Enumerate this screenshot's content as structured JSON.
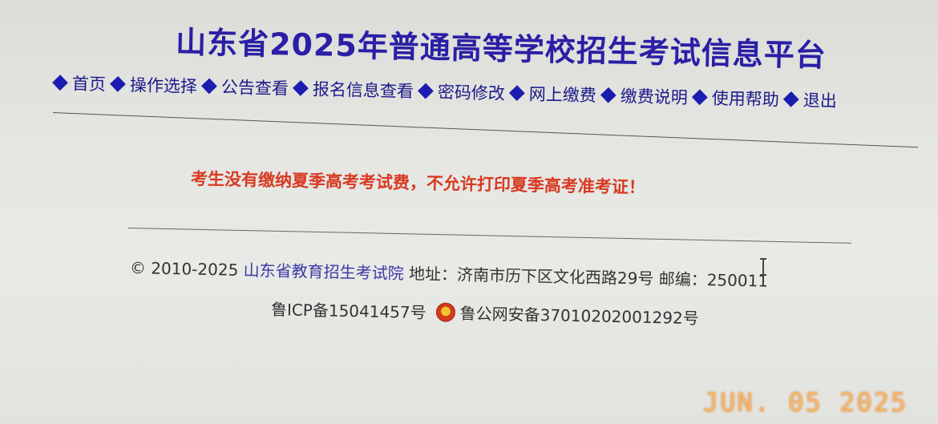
{
  "header": {
    "title": "山东省2025年普通高等学校招生考试信息平台"
  },
  "nav": {
    "items": [
      {
        "label": "首页"
      },
      {
        "label": "操作选择"
      },
      {
        "label": "公告查看"
      },
      {
        "label": "报名信息查看"
      },
      {
        "label": "密码修改"
      },
      {
        "label": "网上缴费"
      },
      {
        "label": "缴费说明"
      },
      {
        "label": "使用帮助"
      },
      {
        "label": "退出"
      }
    ]
  },
  "notice": {
    "text": "考生没有缴纳夏季高考考试费，不允许打印夏季高考准考证！"
  },
  "footer": {
    "copyright": "© 2010-2025",
    "org": "山东省教育招生考试院",
    "address": "地址：济南市历下区文化西路29号 邮编：250011",
    "icp": "鲁ICP备15041457号",
    "police": "鲁公网安备37010202001292号"
  },
  "overlay": {
    "timestamp": "JUN. 05 2025"
  },
  "colors": {
    "title": "#2a1fa6",
    "nav": "#1a1a8a",
    "notice": "#d83a22",
    "timestamp": "#f7b56a"
  }
}
